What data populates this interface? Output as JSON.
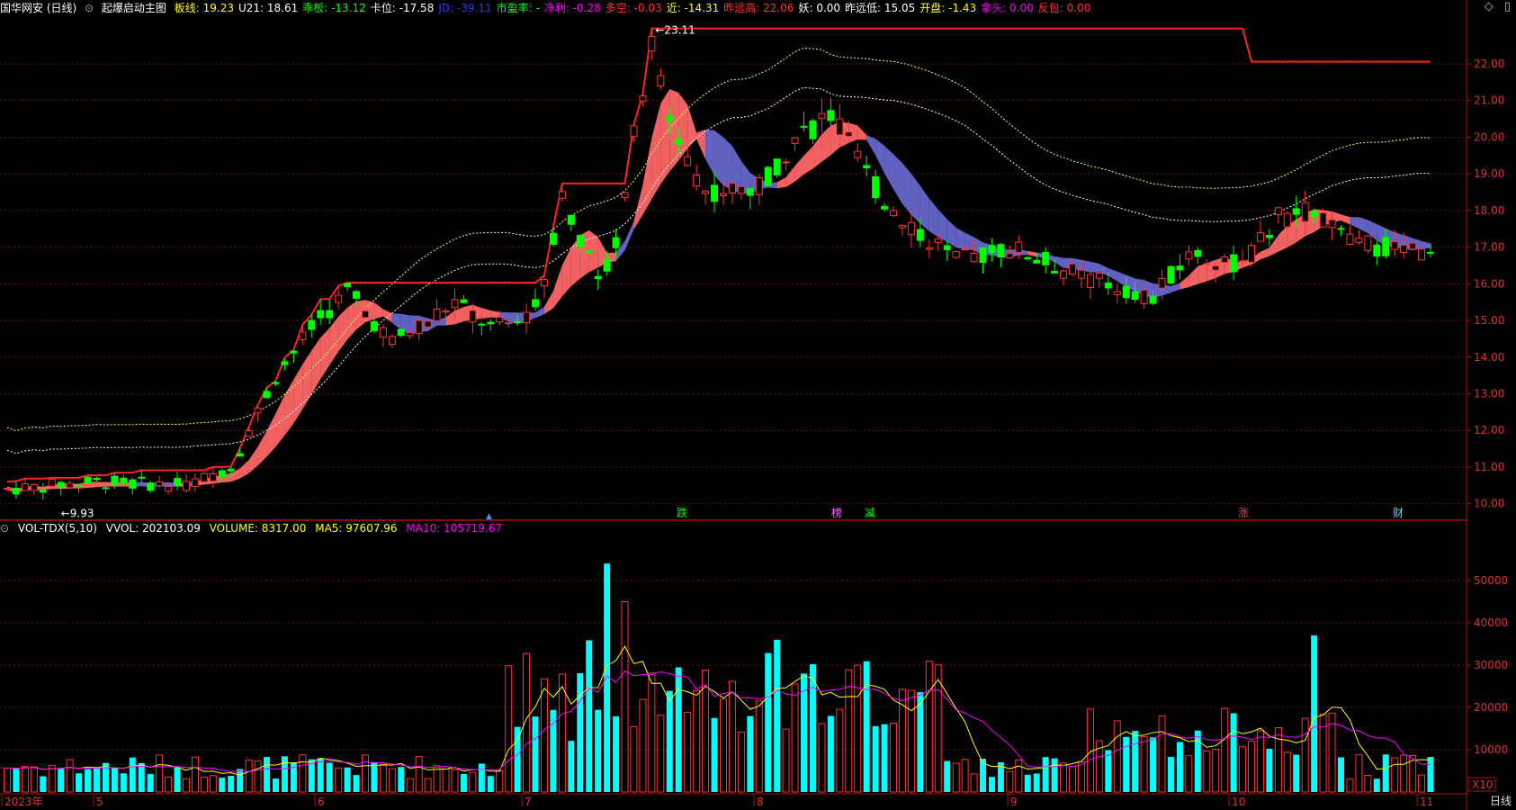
{
  "header": {
    "stock": "国华网安 (日线)",
    "indicator": "起爆启动主图",
    "items": [
      {
        "label": "板线:",
        "value": "19.23",
        "color": "#ffff00"
      },
      {
        "label": "U21:",
        "value": "18.61",
        "color": "#ffffff"
      },
      {
        "label": "乖板:",
        "value": "-13.12",
        "color": "#00ff00"
      },
      {
        "label": "卡位:",
        "value": "-17.58",
        "color": "#ffffff"
      },
      {
        "label": "JD:",
        "value": "-39.11",
        "color": "#3333ff"
      },
      {
        "label": "市盈率:",
        "value": "-",
        "color": "#00ff00"
      },
      {
        "label": "净利:",
        "value": "-0.28",
        "color": "#ff00ff"
      },
      {
        "label": "多空:",
        "value": "-0.03",
        "color": "#ff3333"
      },
      {
        "label": "近:",
        "value": "-14.31",
        "color": "#ffff00"
      },
      {
        "label": "昨远高:",
        "value": "22.06",
        "color": "#ff3333"
      },
      {
        "label": "妖:",
        "value": "0.00",
        "color": "#ffffff"
      },
      {
        "label": "昨远低:",
        "value": "15.05",
        "color": "#ffffff"
      },
      {
        "label": "开盘:",
        "value": "-1.43",
        "color": "#ffff00"
      },
      {
        "label": "拿头:",
        "value": "0.00",
        "color": "#ff00ff"
      },
      {
        "label": "反包:",
        "value": "0.00",
        "color": "#ff3333"
      }
    ]
  },
  "vol_header": {
    "name": "VOL-TDX(5,10)",
    "vvol": "VVOL: 202103.09",
    "volume": "VOLUME: 8317.00",
    "ma5": "MA5: 97607.96",
    "ma10": "MA10: 105719.67"
  },
  "period_label": "日线",
  "x10_label": "X10",
  "annotations": {
    "high": "23.11",
    "low": "9.93",
    "high_mark": "←",
    "low_mark": "←"
  },
  "event_marks": [
    "跌",
    "榜",
    "减",
    "涨",
    "财"
  ],
  "chart_data": {
    "type": "candlestick",
    "price_axis": {
      "ticks": [
        "22.00",
        "21.00",
        "20.00",
        "19.00",
        "18.00",
        "17.00",
        "16.00",
        "15.00",
        "14.00",
        "13.00",
        "12.00",
        "11.00",
        "10.00"
      ],
      "ylim": [
        9.6,
        23.3
      ]
    },
    "volume_axis": {
      "ticks": [
        "50000",
        "40000",
        "30000",
        "20000",
        "10000"
      ],
      "ylim": [
        0,
        60000
      ]
    },
    "x_labels": [
      "2023年",
      "5",
      "6",
      "7",
      "8",
      "9",
      "10",
      "11"
    ],
    "colors": {
      "up": "#ff3333",
      "down": "#00ffff",
      "ma5": "#ffff00",
      "ma10": "#ff00ff",
      "band_up": "#ff6666",
      "band_down": "#6666cc",
      "ladder": "#ff2222"
    }
  }
}
